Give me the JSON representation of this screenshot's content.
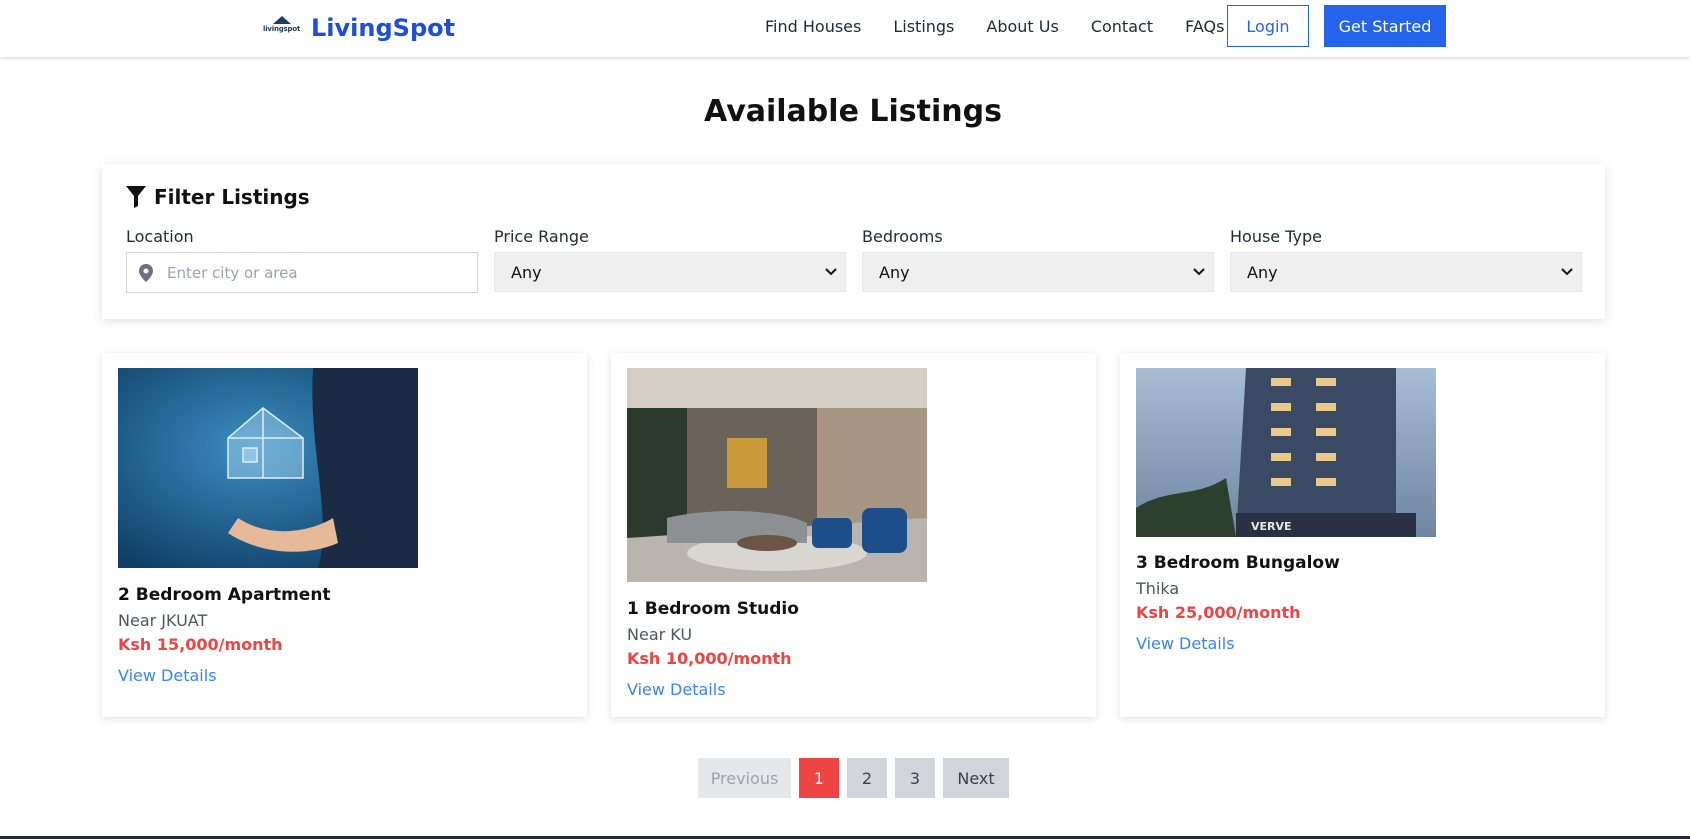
{
  "header": {
    "logo_text": "livingspot",
    "brand": "LivingSpot",
    "nav": [
      "Find Houses",
      "Listings",
      "About Us",
      "Contact",
      "FAQs"
    ],
    "login_label": "Login",
    "cta_label": "Get Started",
    "accent_color": "#2563eb"
  },
  "page_title": "Available Listings",
  "filter": {
    "title": "Filter Listings",
    "icon": "filter-funnel-icon",
    "location": {
      "label": "Location",
      "placeholder": "Enter city or area",
      "value": "",
      "icon": "map-pin-icon"
    },
    "price": {
      "label": "Price Range",
      "selected": "Any"
    },
    "bedrooms": {
      "label": "Bedrooms",
      "selected": "Any"
    },
    "house_type": {
      "label": "House Type",
      "selected": "Any"
    }
  },
  "listings": [
    {
      "title": "2 Bedroom Apartment",
      "location": "Near JKUAT",
      "price": "Ksh 15,000/month",
      "link": "View Details",
      "image": "hand-holding-house-photo"
    },
    {
      "title": "1 Bedroom Studio",
      "location": "Near KU",
      "price": "Ksh 10,000/month",
      "link": "View Details",
      "image": "living-room-interior-photo"
    },
    {
      "title": "3 Bedroom Bungalow",
      "location": "Thika",
      "price": "Ksh 25,000/month",
      "link": "View Details",
      "image": "apartment-tower-photo",
      "image_caption": "VERVE"
    }
  ],
  "pagination": {
    "previous": "Previous",
    "pages": [
      "1",
      "2",
      "3"
    ],
    "current": "1",
    "next": "Next",
    "active_color": "#ef4444"
  },
  "colors": {
    "price": "#ef4444",
    "link": "#3b82f6"
  }
}
